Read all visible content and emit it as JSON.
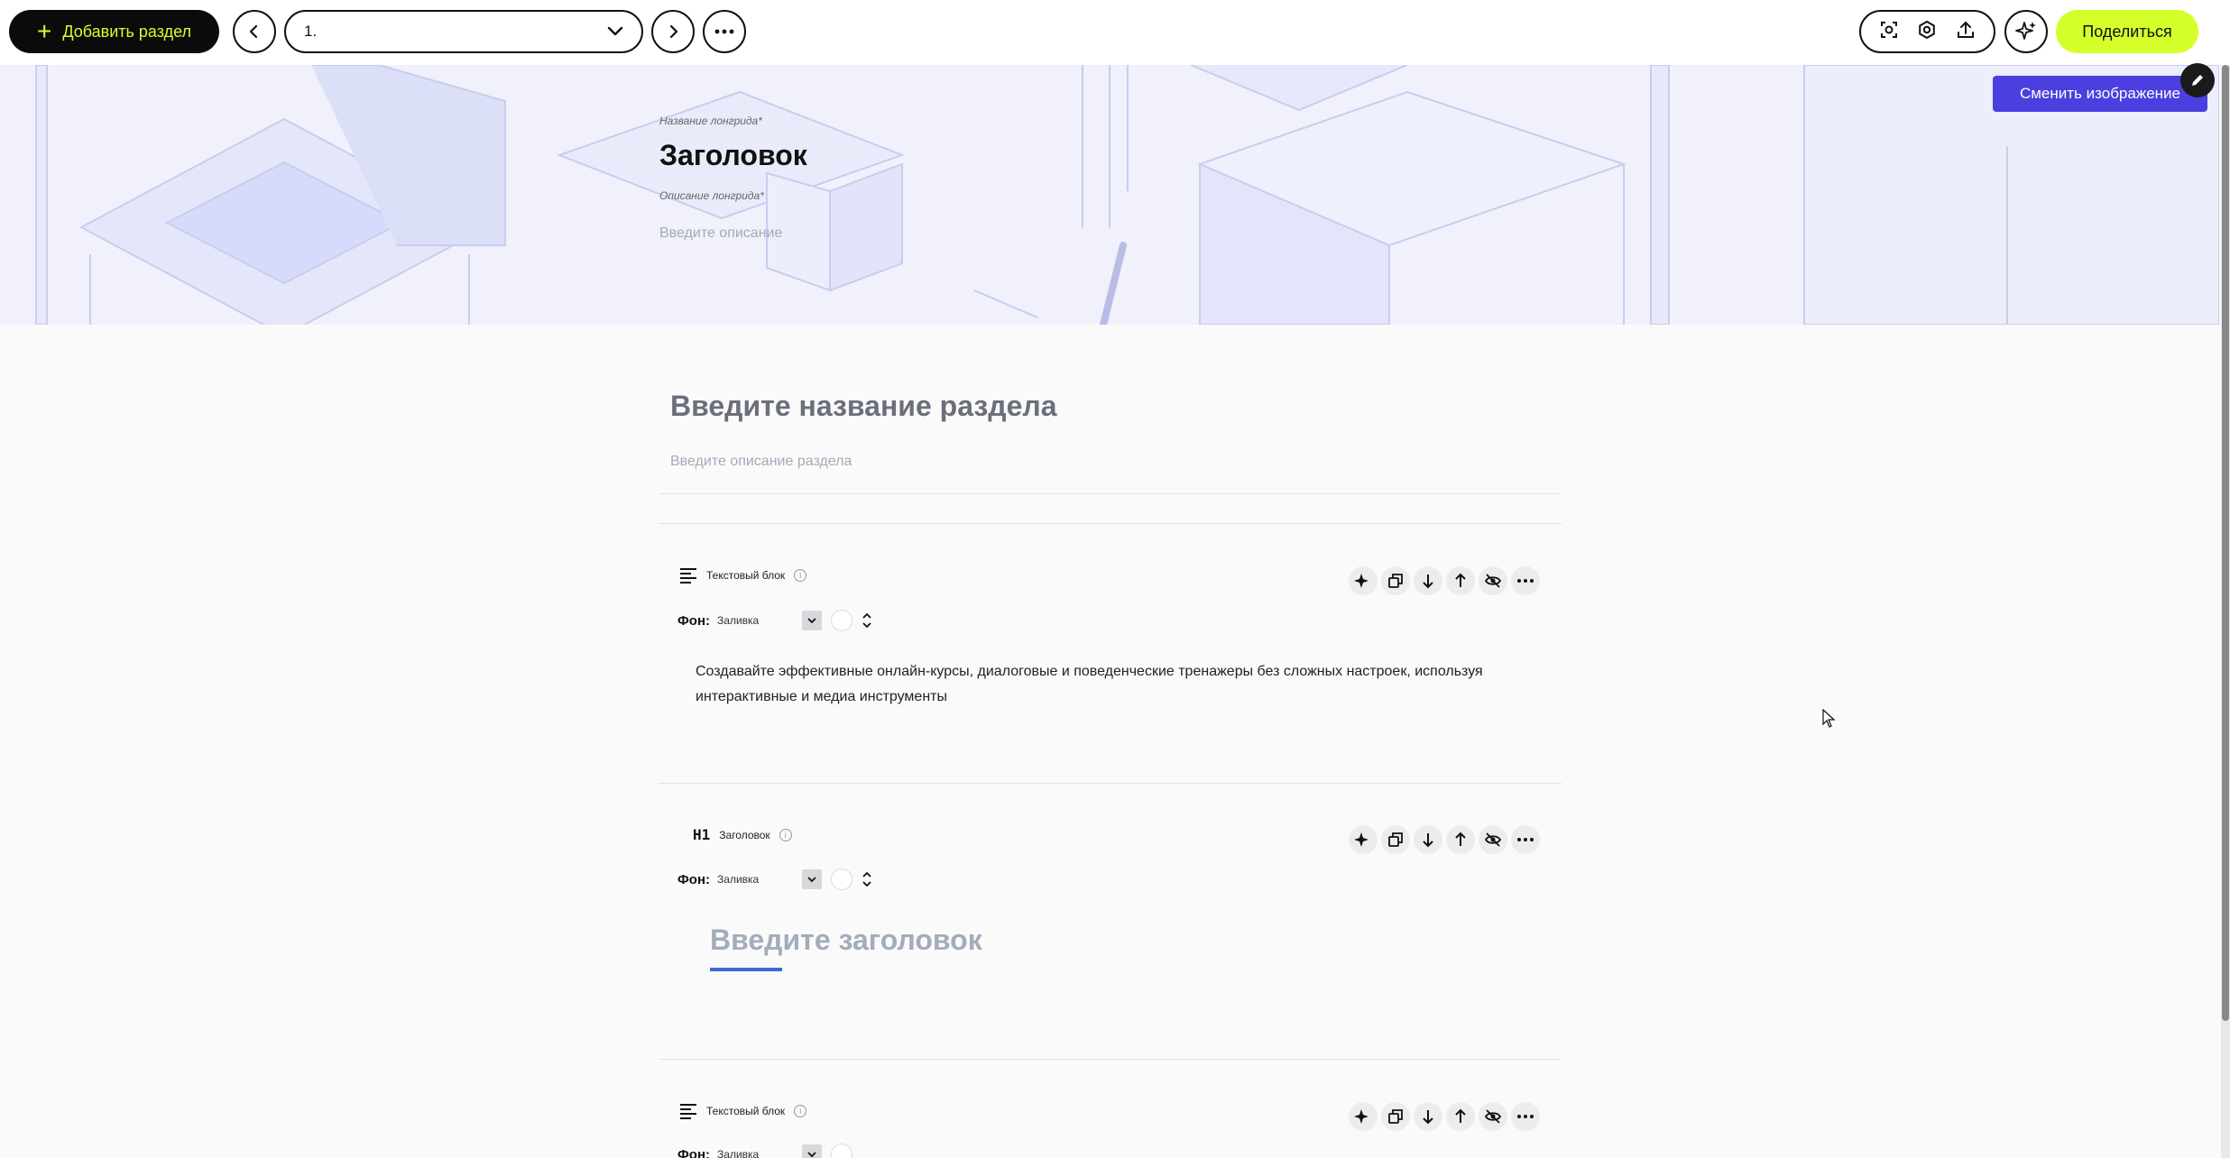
{
  "toolbar": {
    "add_section_label": "Добавить раздел",
    "section_select_value": "1.",
    "share_label": "Поделиться"
  },
  "cover": {
    "title_label": "Название лонгрида*",
    "title": "Заголовок",
    "desc_label": "Описание лонгрида*",
    "desc_placeholder": "Введите описание",
    "change_image_label": "Сменить изображение"
  },
  "section": {
    "title_placeholder": "Введите название раздела",
    "desc_placeholder": "Введите описание раздела"
  },
  "blocks": [
    {
      "type_label": "Текстовый блок",
      "fon_label": "Фон:",
      "fill_label": "Заливка",
      "text": "Создавайте эффективные онлайн-курсы, диалоговые и поведенческие тренажеры без сложных настроек, используя интерактивные и медиа инструменты"
    },
    {
      "tag": "H1",
      "type_label": "Заголовок",
      "fon_label": "Фон:",
      "fill_label": "Заливка",
      "heading_placeholder": "Введите заголовок"
    },
    {
      "type_label": "Текстовый блок",
      "fon_label": "Фон:",
      "fill_label": "Заливка"
    }
  ],
  "colors": {
    "accent_lime": "#d4ff2a",
    "accent_purple": "#4b3fe0",
    "heading_underline": "#3a6ad6"
  }
}
